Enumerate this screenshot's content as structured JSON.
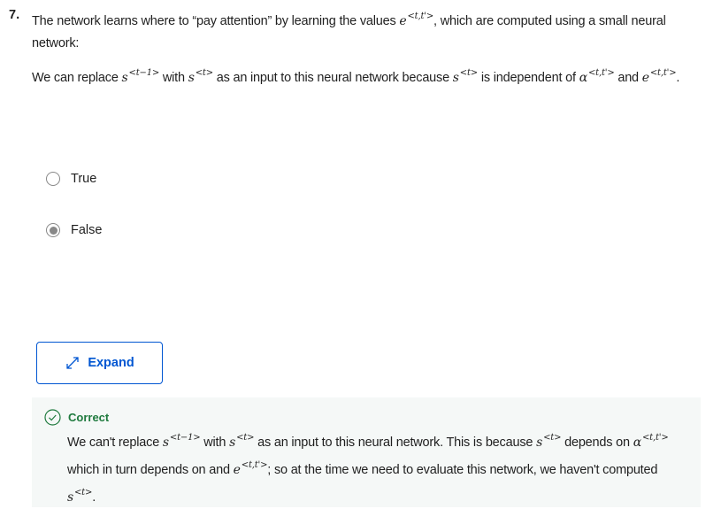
{
  "question": {
    "number": "7.",
    "prompt": [
      {
        "t": "The network learns where to “pay attention” by learning the values "
      },
      {
        "m": "e",
        "sup": "<t,t'>"
      },
      {
        "t": ", which are computed using a small neural network:"
      }
    ],
    "statement": [
      {
        "t": "We can replace "
      },
      {
        "m": "s",
        "sup": "<t−1>"
      },
      {
        "t": " with "
      },
      {
        "m": "s",
        "sup": "<t>"
      },
      {
        "t": " as an input to this neural network because "
      },
      {
        "m": "s",
        "sup": "<t>"
      },
      {
        "t": " is independent of "
      },
      {
        "m": "α",
        "sup": "<t,t'>"
      },
      {
        "t": " and "
      },
      {
        "m": "e",
        "sup": "<t,t'>"
      },
      {
        "t": "."
      }
    ]
  },
  "options": [
    {
      "label": "True",
      "selected": false
    },
    {
      "label": "False",
      "selected": true
    }
  ],
  "expand_button": {
    "label": "Expand"
  },
  "feedback": {
    "status": "Correct",
    "color": "#1f7a3e",
    "text": [
      {
        "t": "We can't replace "
      },
      {
        "m": "s",
        "sup": "<t−1>"
      },
      {
        "t": " with "
      },
      {
        "m": "s",
        "sup": "<t>"
      },
      {
        "t": " as an input to this neural network. This is because "
      },
      {
        "m": "s",
        "sup": "<t>"
      },
      {
        "t": " depends on "
      },
      {
        "m": "α",
        "sup": "<t,t'>"
      },
      {
        "t": " which in turn depends on and "
      },
      {
        "m": "e",
        "sup": "<t,t'>"
      },
      {
        "t": "; so at the time we need to evaluate this network, we haven't computed "
      },
      {
        "m": "s",
        "sup": "<t>"
      },
      {
        "t": "."
      }
    ]
  }
}
